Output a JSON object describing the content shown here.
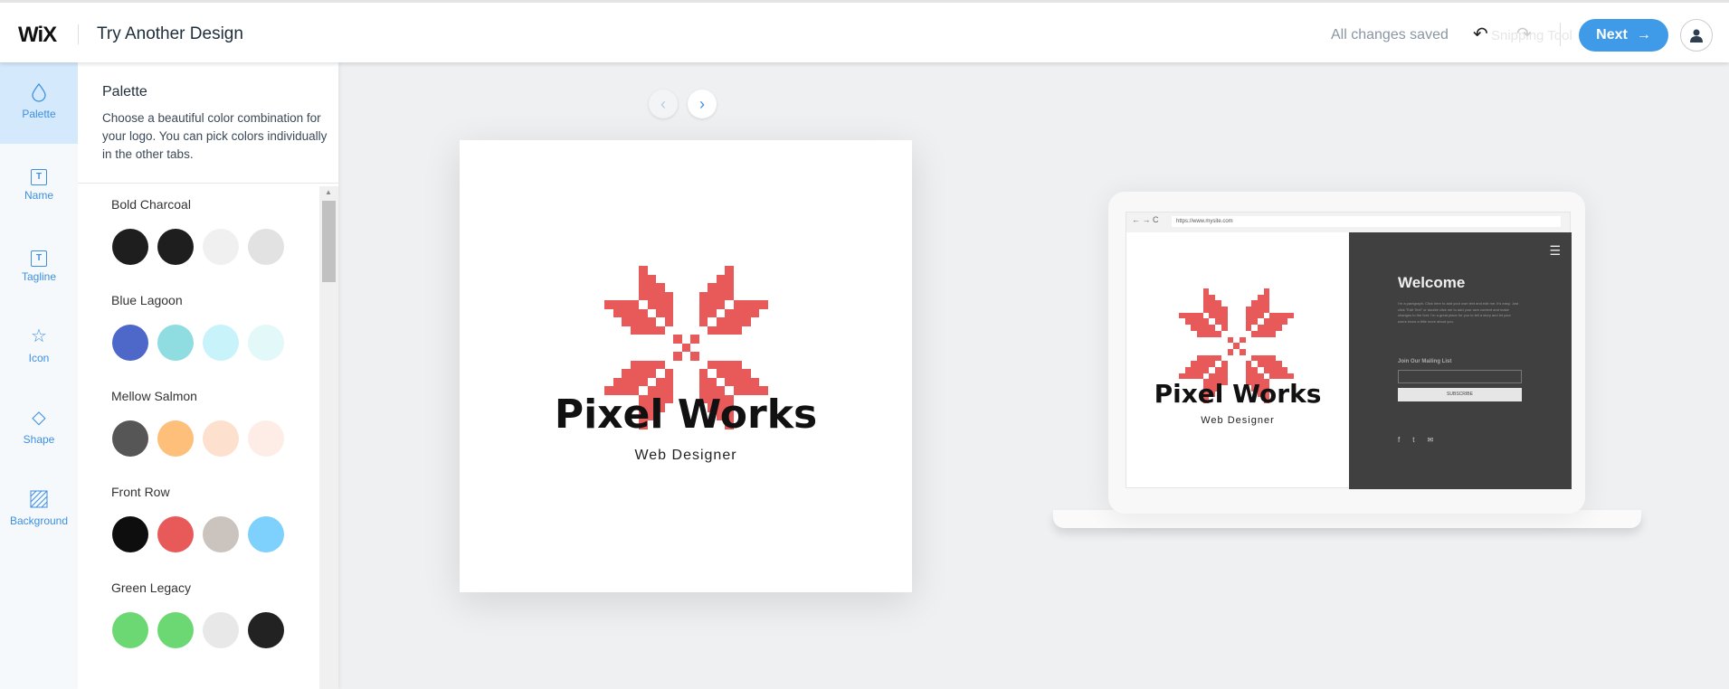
{
  "header": {
    "brand": "WiX",
    "title": "Try Another Design",
    "status": "All changes saved",
    "overlay_text": "Snipping Tool",
    "next_label": "Next",
    "accent": "#3f9be8"
  },
  "sidebar": {
    "items": [
      {
        "label": "Palette",
        "icon": "drop-icon",
        "active": true
      },
      {
        "label": "Name",
        "icon": "text-box-icon"
      },
      {
        "label": "Tagline",
        "icon": "text-box-icon"
      },
      {
        "label": "Icon",
        "icon": "star-icon"
      },
      {
        "label": "Shape",
        "icon": "diamond-icon"
      },
      {
        "label": "Background",
        "icon": "hatch-icon"
      }
    ]
  },
  "panel": {
    "title": "Palette",
    "description": "Choose a beautiful color combination for your logo. You can pick colors individually in the other tabs.",
    "palettes": [
      {
        "name": "Bold Charcoal",
        "colors": [
          "#1e1e1e",
          "#1e1e1e",
          "#f0f0f0",
          "#e2e2e2"
        ]
      },
      {
        "name": "Blue Lagoon",
        "colors": [
          "#4d68c8",
          "#8fdde0",
          "#c9f3fb",
          "#e3f8f8"
        ]
      },
      {
        "name": "Mellow Salmon",
        "colors": [
          "#565656",
          "#fdbf7a",
          "#fde0cd",
          "#fdede6"
        ]
      },
      {
        "name": "Front Row",
        "colors": [
          "#0e0e0e",
          "#e85a5a",
          "#cbc3bd",
          "#7fd1fd"
        ]
      },
      {
        "name": "Green Legacy",
        "colors": [
          "#6cd873",
          "#6cd873",
          "#e8e8e8",
          "#222222"
        ]
      }
    ]
  },
  "logo": {
    "name": "Pixel Works",
    "tagline": "Web Designer",
    "icon_color": "#e85a5a"
  },
  "mockup": {
    "url": "https://www.mysite.com",
    "heading": "Welcome",
    "paragraph": "I'm a paragraph. Click here to add your own text and edit me. It's easy. Just click \"Edit Text\" or double click me to add your own content and make changes to the font. I'm a great place for you to tell a story and let your users know a little more about you.",
    "mailing": "Join Our Mailing List",
    "subscribe": "SUBSCRIBE"
  }
}
